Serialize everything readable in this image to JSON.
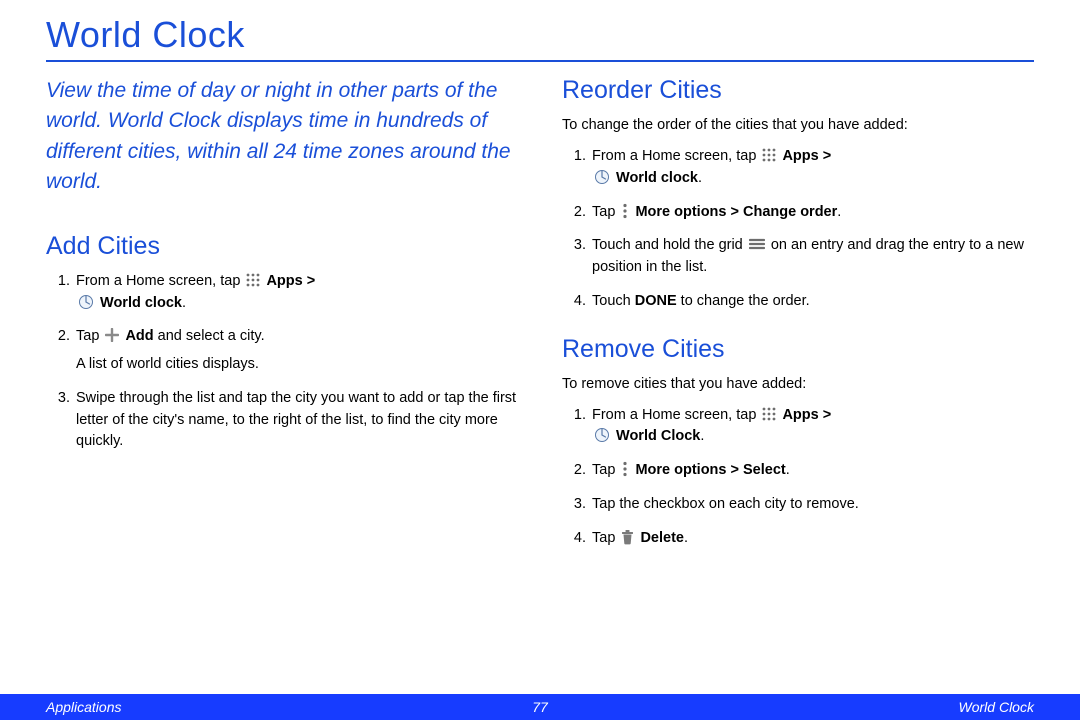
{
  "page_title": "World Clock",
  "intro": "View the time of day or night in other parts of the world. World Clock displays time in hundreds of different cities, within all 24 time zones around the world.",
  "sections": {
    "add": {
      "heading": "Add Cities",
      "steps": {
        "s1_prefix": "From a Home screen, tap ",
        "s1_apps": "Apps >",
        "s1_world": "World clock",
        "s2_prefix": "Tap ",
        "s2_add": "Add",
        "s2_suffix": " and select a city.",
        "s2_sub": "A list of world cities displays.",
        "s3": "Swipe through the list and tap the city you want to add or tap the first letter of the city's name, to the right of the list, to find the city more quickly."
      }
    },
    "reorder": {
      "heading": "Reorder Cities",
      "lead": "To change the order of the cities that you have added:",
      "steps": {
        "s1_prefix": "From a Home screen, tap ",
        "s1_apps": "Apps >",
        "s1_world": "World clock",
        "s2_prefix": "Tap ",
        "s2_more": "More options > Change order",
        "s3_prefix": "Touch and hold the grid ",
        "s3_suffix": " on an entry and drag the entry to a new position in the list.",
        "s4_prefix": "Touch ",
        "s4_done": "DONE",
        "s4_suffix": " to change the order."
      }
    },
    "remove": {
      "heading": "Remove Cities",
      "lead": "To remove cities that you have added:",
      "steps": {
        "s1_prefix": "From a Home screen, tap ",
        "s1_apps": "Apps >",
        "s1_world": "World Clock",
        "s2_prefix": "Tap ",
        "s2_more": "More options > Select",
        "s3": "Tap the checkbox on each city to remove.",
        "s4_prefix": "Tap ",
        "s4_delete": "Delete"
      }
    }
  },
  "footer": {
    "left": "Applications",
    "page_number": "77",
    "right": "World Clock"
  }
}
